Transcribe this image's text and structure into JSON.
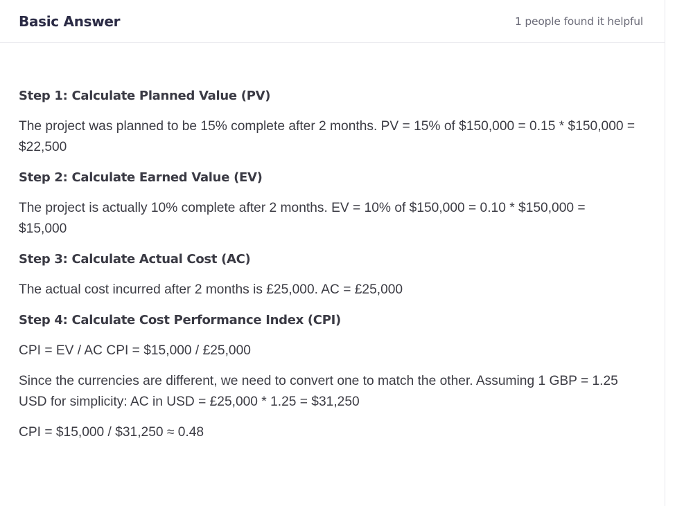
{
  "header": {
    "title": "Basic Answer",
    "helpful": "1 people found it helpful"
  },
  "steps": [
    {
      "heading": "Step 1: Calculate Planned Value (PV)",
      "paragraphs": [
        "The project was planned to be 15% complete after 2 months. PV = 15% of $150,000 = 0.15 * $150,000 = $22,500"
      ]
    },
    {
      "heading": "Step 2: Calculate Earned Value (EV)",
      "paragraphs": [
        "The project is actually 10% complete after 2 months. EV = 10% of $150,000 = 0.10 * $150,000 = $15,000"
      ]
    },
    {
      "heading": "Step 3: Calculate Actual Cost (AC)",
      "paragraphs": [
        "The actual cost incurred after 2 months is £25,000. AC = £25,000"
      ]
    },
    {
      "heading": "Step 4: Calculate Cost Performance Index (CPI)",
      "paragraphs": [
        "CPI = EV / AC CPI = $15,000 / £25,000",
        "Since the currencies are different, we need to convert one to match the other. Assuming 1 GBP = 1.25 USD for simplicity: AC in USD = £25,000 * 1.25 = $31,250",
        "CPI = $15,000 / $31,250 ≈ 0.48"
      ]
    }
  ]
}
